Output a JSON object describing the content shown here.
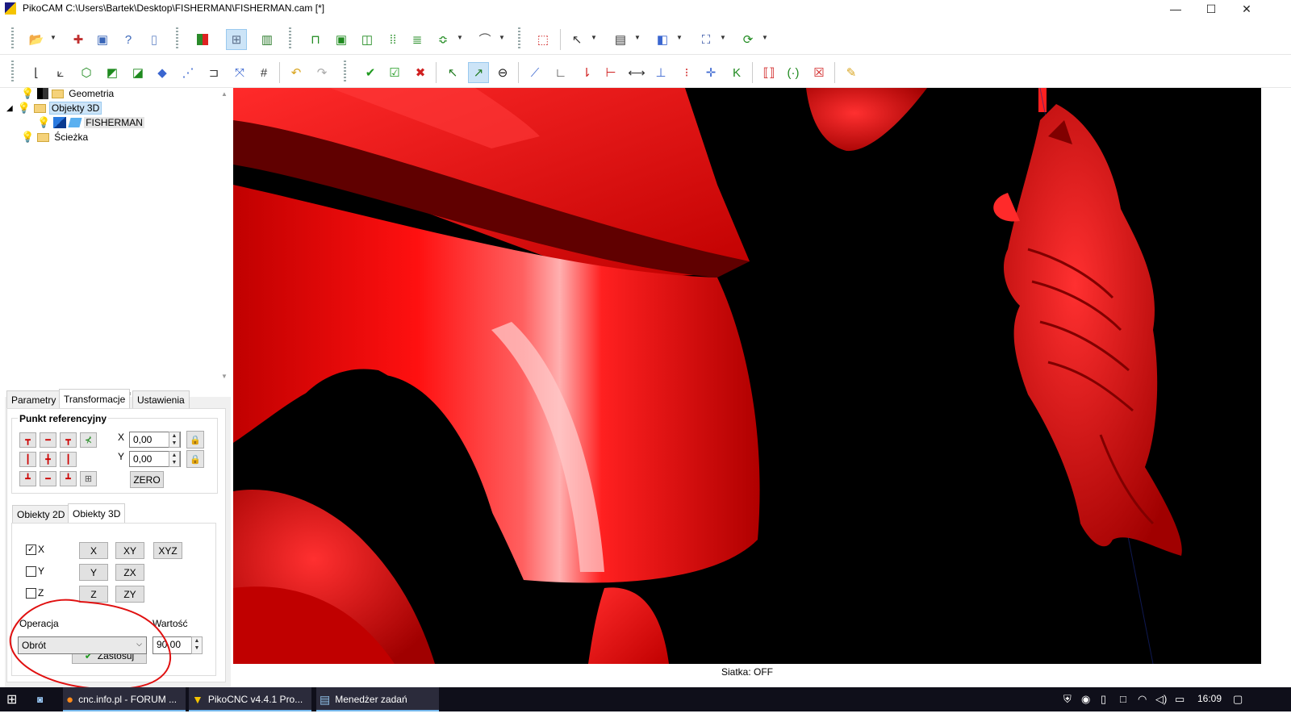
{
  "window": {
    "title": "PikoCAM  C:\\Users\\Bartek\\Desktop\\FISHERMAN\\FISHERMAN.cam [*]",
    "minimize_glyph": "—",
    "maximize_glyph": "☐",
    "close_glyph": "✕"
  },
  "toolbar1": {
    "icons": [
      "open-icon",
      "new-icon",
      "save-icon",
      "help-icon",
      "blank-page-icon",
      "color-palette-icon",
      "grid-view-icon",
      "bar-chart-icon",
      "profile-icon",
      "pocket-icon",
      "contour-icon",
      "drill-pattern-icon",
      "layers-icon",
      "distribute-icon",
      "curve-icon",
      "rectangle-select-icon",
      "pointer-icon",
      "clipboard-icon",
      "boolean-icon",
      "transform-box-icon",
      "refresh-icon"
    ]
  },
  "toolbar2": {
    "icons": [
      "axis-origin-icon",
      "axis-origin-2-icon",
      "box-view-icon",
      "box-top-icon",
      "box-front-icon",
      "box-side-icon",
      "point-icon",
      "step-icon",
      "fit-view-icon",
      "grid-icon",
      "undo-icon",
      "redo-icon",
      "accept-icon",
      "accept-all-icon",
      "cancel-icon",
      "select-icon",
      "select-add-icon",
      "eye-icon",
      "knife-icon",
      "angle-icon",
      "vertical-icon",
      "horizontal-icon",
      "distance-icon",
      "snap-icon",
      "dotted-line-icon",
      "center-icon",
      "k-tool-icon",
      "mirror-icon",
      "center-mirror-icon",
      "edit-icon",
      "brush-icon"
    ]
  },
  "tree": {
    "items": [
      {
        "label": "Geometria"
      },
      {
        "label": "Objekty 3D"
      },
      {
        "label": "FISHERMAN"
      },
      {
        "label": "Ścieżka"
      }
    ]
  },
  "panel": {
    "tabs": [
      "Parametry",
      "Transformacje",
      "Ustawienia"
    ],
    "active_tab": "Transformacje",
    "ref_group_title": "Punkt referencyjny",
    "x_label": "X",
    "x_value": "0,00",
    "y_label": "Y",
    "y_value": "0,00",
    "zero_label": "ZERO",
    "subtabs": [
      "Obiekty 2D",
      "Obiekty 3D"
    ],
    "active_subtab": "Obiekty 3D",
    "checks": [
      {
        "label": "X",
        "checked": true
      },
      {
        "label": "Y",
        "checked": false
      },
      {
        "label": "Z",
        "checked": false
      }
    ],
    "axis_buttons": [
      "X",
      "XY",
      "XYZ",
      "Y",
      "ZX",
      "Z",
      "ZY"
    ],
    "operation_label": "Operacja",
    "operation_value": "Obrót",
    "value_label": "Wartość",
    "value": "90,00",
    "apply_label": "Zastosuj"
  },
  "status": {
    "text": "Siatka: OFF"
  },
  "taskbar": {
    "items": [
      {
        "label": "cnc.info.pl - FORUM ...",
        "icon": "firefox-icon"
      },
      {
        "label": "PikoCNC v4.4.1   Pro...",
        "icon": "pikocnc-icon"
      },
      {
        "label": "Menedżer zadań",
        "icon": "task-manager-icon"
      }
    ],
    "clock": "16:09"
  },
  "colors": {
    "model": "#ff0000",
    "viewport_bg": "#000000",
    "annotation": "#e01010",
    "selection": "#cce4f7"
  }
}
